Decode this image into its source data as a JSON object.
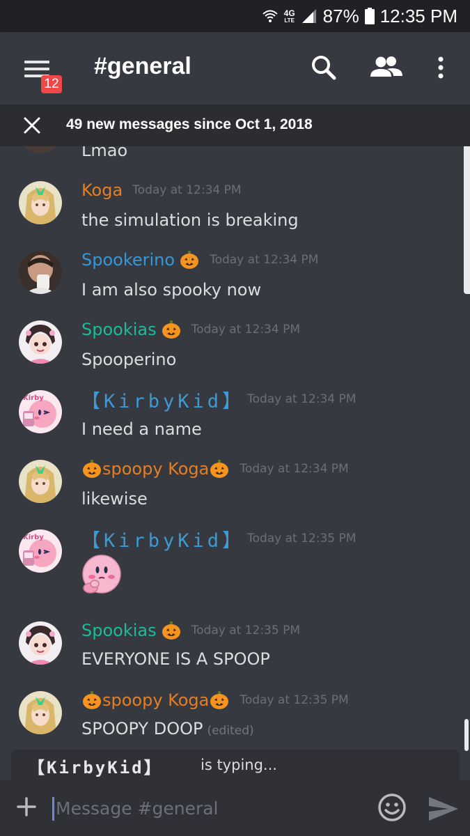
{
  "status_bar": {
    "network": "4G",
    "network_sub": "LTE",
    "battery": "87%",
    "time": "12:35 PM"
  },
  "header": {
    "menu_badge": "12",
    "channel": "#general"
  },
  "new_messages_bar": {
    "text": "49 new messages since Oct 1, 2018"
  },
  "colors": {
    "background": "#36393f",
    "orange_name": "#e67e22",
    "blue_name": "#3498db",
    "teal_name": "#1abc9c",
    "kirby_name": "#3b9bd6",
    "timestamp": "#6b6f76",
    "text": "#dcddde"
  },
  "messages": [
    {
      "author": "",
      "time": "",
      "content": "Lmao"
    },
    {
      "author": "Koga",
      "time": "Today at 12:34 PM",
      "content": "the simulation is breaking"
    },
    {
      "author": "Spookerino",
      "time": "Today at 12:34 PM",
      "content": "I am also spooky now"
    },
    {
      "author": "Spookias",
      "time": "Today at 12:34 PM",
      "content": "Spooperino"
    },
    {
      "author": "【KirbyKid】",
      "time": "Today at 12:34 PM",
      "content": "I need a name"
    },
    {
      "author": "spoopy Koga",
      "time": "Today at 12:34 PM",
      "content": "likewise"
    },
    {
      "author": "【KirbyKid】",
      "time": "Today at 12:35 PM",
      "content": "",
      "emoji": "thinking-kirby"
    },
    {
      "author": "Spookias",
      "time": "Today at 12:35 PM",
      "content": "EVERYONE IS A SPOOP"
    },
    {
      "author": "spoopy Koga",
      "time": "Today at 12:35 PM",
      "content": "SPOOPY DOOP",
      "edited": "(edited)"
    }
  ],
  "typing": {
    "name": "【KirbyKid】",
    "text": "is typing..."
  },
  "composer": {
    "placeholder": "Message #general"
  }
}
